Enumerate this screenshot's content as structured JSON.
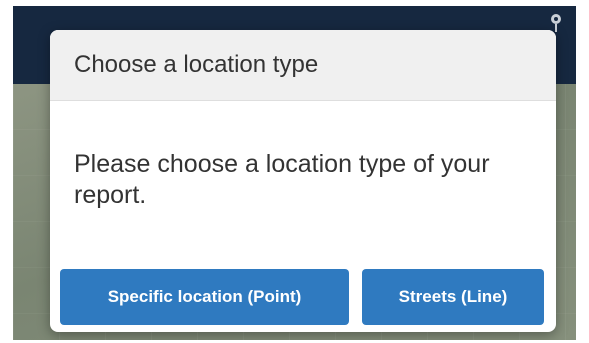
{
  "dialog": {
    "title": "Choose a location type",
    "message": "Please choose a location type of your report.",
    "buttons": {
      "point_label": "Specific location (Point)",
      "line_label": "Streets (Line)"
    }
  },
  "colors": {
    "header_bar": "#162840",
    "button_primary": "#2f7ac0",
    "modal_header_bg": "#f0f0f0"
  },
  "icons": {
    "map_pin": "map-pin-icon"
  }
}
